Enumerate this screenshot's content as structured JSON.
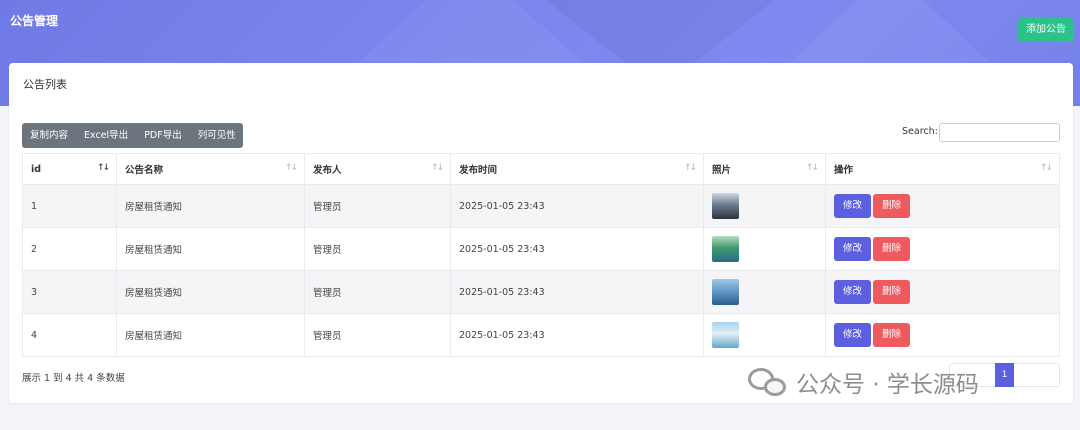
{
  "header": {
    "title": "公告管理",
    "add_button": "添加公告"
  },
  "card": {
    "title": "公告列表"
  },
  "toolbar": {
    "buttons": [
      "复制内容",
      "Excel导出",
      "PDF导出",
      "列可见性"
    ]
  },
  "search": {
    "label": "Search:",
    "value": ""
  },
  "table": {
    "columns": [
      "id",
      "公告名称",
      "发布人",
      "发布时间",
      "照片",
      "操作"
    ],
    "rows": [
      {
        "id": "1",
        "name": "房屋租赁通知",
        "publisher": "管理员",
        "time": "2025-01-05 23:43",
        "photo": "photo-thumbnail"
      },
      {
        "id": "2",
        "name": "房屋租赁通知",
        "publisher": "管理员",
        "time": "2025-01-05 23:43",
        "photo": "photo-thumbnail"
      },
      {
        "id": "3",
        "name": "房屋租赁通知",
        "publisher": "管理员",
        "time": "2025-01-05 23:43",
        "photo": "photo-thumbnail"
      },
      {
        "id": "4",
        "name": "房屋租赁通知",
        "publisher": "管理员",
        "time": "2025-01-05 23:43",
        "photo": "photo-thumbnail"
      }
    ],
    "edit_label": "修改",
    "delete_label": "删除"
  },
  "footer": {
    "summary": "展示 1 到 4 共 4 条数据"
  },
  "pagination": {
    "current": "1"
  },
  "watermark": {
    "text": "公众号 · 学长源码"
  },
  "colors": {
    "banner": "#7b85ec",
    "add_button": "#2ac28a",
    "edit": "#5b5fe0",
    "delete": "#ef5a5f",
    "toolbar": "#6c757d"
  }
}
